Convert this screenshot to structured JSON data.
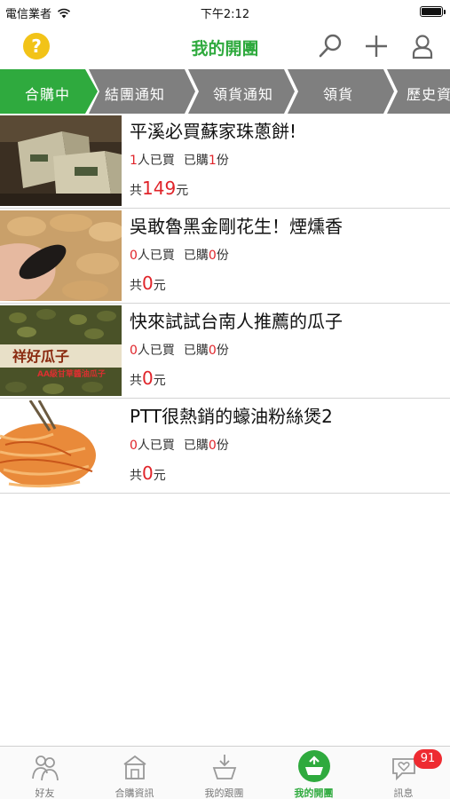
{
  "status_bar": {
    "carrier": "電信業者",
    "time": "下午2:12"
  },
  "nav": {
    "title": "我的開團"
  },
  "steps": [
    {
      "label": "合購中",
      "active": true
    },
    {
      "label": "結團通知",
      "active": false
    },
    {
      "label": "領貨通知",
      "active": false
    },
    {
      "label": "領貨",
      "active": false
    },
    {
      "label": "歷史資",
      "active": false
    }
  ],
  "items": [
    {
      "title": "平溪必買蘇家珠蔥餅!",
      "buyers": "1",
      "buyers_unit": "人已買",
      "bought_prefix": "已購",
      "bought": "1",
      "bought_unit": "份",
      "total_prefix": "共",
      "total": "149",
      "total_unit": "元"
    },
    {
      "title": "吳敢魯黑金剛花生！煙燻香",
      "buyers": "0",
      "buyers_unit": "人已買",
      "bought_prefix": "已購",
      "bought": "0",
      "bought_unit": "份",
      "total_prefix": "共",
      "total": "0",
      "total_unit": "元"
    },
    {
      "title": "快來試試台南人推薦的瓜子",
      "buyers": "0",
      "buyers_unit": "人已買",
      "bought_prefix": "已購",
      "bought": "0",
      "bought_unit": "份",
      "total_prefix": "共",
      "total": "0",
      "total_unit": "元",
      "thumb_text": "祥好瓜子",
      "thumb_sub": "AA級甘草醬油瓜子"
    },
    {
      "title": "PTT很熱銷的蠔油粉絲煲2",
      "buyers": "0",
      "buyers_unit": "人已買",
      "bought_prefix": "已購",
      "bought": "0",
      "bought_unit": "份",
      "total_prefix": "共",
      "total": "0",
      "total_unit": "元"
    }
  ],
  "tab_bar": [
    {
      "label": "好友",
      "icon": "friends-icon"
    },
    {
      "label": "合購資訊",
      "icon": "store-icon"
    },
    {
      "label": "我的跟團",
      "icon": "basket-download-icon"
    },
    {
      "label": "我的開團",
      "icon": "basket-upload-icon",
      "active": true
    },
    {
      "label": "訊息",
      "icon": "message-heart-icon",
      "badge": "91"
    }
  ],
  "colors": {
    "accent_green": "#2faa3e",
    "step_gray": "#7f7f7f",
    "price_red": "#e0242a",
    "badge_red": "#ee2b31",
    "help_yellow": "#f2c318"
  }
}
